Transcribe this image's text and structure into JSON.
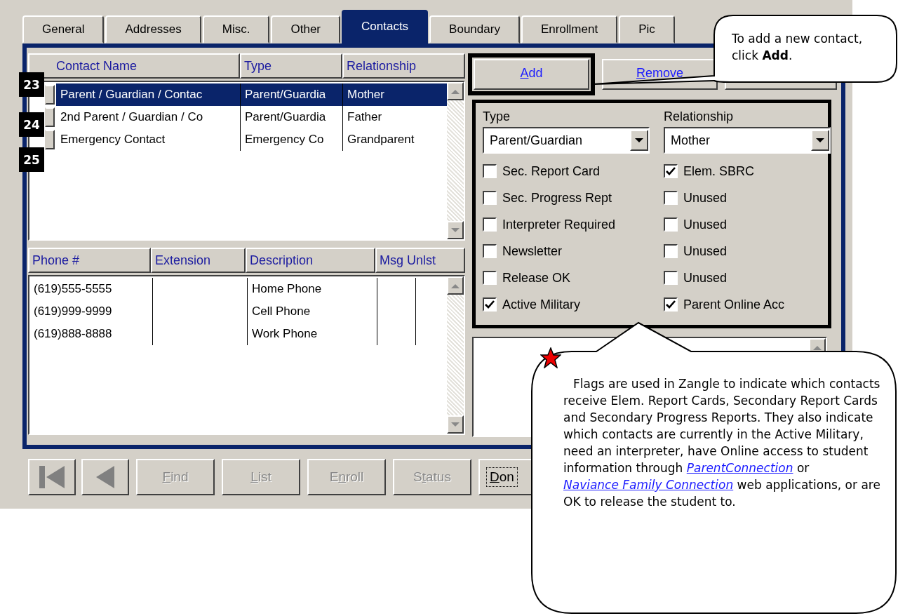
{
  "tabs": [
    {
      "label": "General",
      "selected": false
    },
    {
      "label": "Addresses",
      "selected": false
    },
    {
      "label": "Misc.",
      "selected": false
    },
    {
      "label": "Other",
      "selected": false
    },
    {
      "label": "Contacts",
      "selected": true
    },
    {
      "label": "Boundary",
      "selected": false
    },
    {
      "label": "Enrollment",
      "selected": false
    },
    {
      "label": "Pic",
      "selected": false
    }
  ],
  "contacts": {
    "columns": [
      "Contact Name",
      "Type",
      "Relationship"
    ],
    "rows": [
      {
        "name": "Parent / Guardian / Contac",
        "type": "Parent/Guardia",
        "relationship": "Mother",
        "selected": true
      },
      {
        "name": "2nd Parent / Guardian / Co",
        "type": "Parent/Guardia",
        "relationship": "Father",
        "selected": false
      },
      {
        "name": "Emergency Contact",
        "type": "Emergency Co",
        "relationship": "Grandparent",
        "selected": false
      }
    ]
  },
  "phones": {
    "columns": [
      "Phone #",
      "Extension",
      "Description",
      "Msg Unlst"
    ],
    "rows": [
      {
        "phone": "(619)555-5555",
        "description": "Home Phone"
      },
      {
        "phone": "(619)999-9999",
        "description": "Cell Phone"
      },
      {
        "phone": "(619)888-8888",
        "description": "Work Phone"
      }
    ]
  },
  "actions": [
    {
      "label": {
        "key": "A",
        "after": "dd"
      },
      "highlighted": true
    },
    {
      "label": {
        "key": "R",
        "after": "emove"
      },
      "highlighted": false
    }
  ],
  "fields": [
    {
      "label": "Type",
      "value": "Parent/Guardian"
    },
    {
      "label": "Relationship",
      "value": "Mother"
    }
  ],
  "flags": [
    {
      "label": "Sec. Report Card",
      "checked": false
    },
    {
      "label": "Elem. SBRC",
      "checked": true
    },
    {
      "label": "Sec. Progress Rept",
      "checked": false
    },
    {
      "label": "Unused",
      "checked": false
    },
    {
      "label": "Interpreter Required",
      "checked": false
    },
    {
      "label": "Unused",
      "checked": false
    },
    {
      "label": "Newsletter",
      "checked": false
    },
    {
      "label": "Unused",
      "checked": false
    },
    {
      "label": "Release OK",
      "checked": false
    },
    {
      "label": "Unused",
      "checked": false
    },
    {
      "label": "Active Military",
      "checked": true
    },
    {
      "label": "Parent Online Acc",
      "checked": true
    }
  ],
  "nav": [
    {
      "kind": "first",
      "disabled": true
    },
    {
      "kind": "previous",
      "disabled": true
    },
    {
      "kind": "text",
      "label": {
        "key": "F",
        "after": "ind"
      },
      "disabled": true
    },
    {
      "kind": "text",
      "label": {
        "key": "L",
        "after": "ist"
      },
      "disabled": true
    },
    {
      "kind": "text",
      "label": {
        "before": "E",
        "key": "n",
        "after": "roll"
      },
      "disabled": true
    },
    {
      "kind": "text",
      "label": {
        "before": "S",
        "key": "t",
        "after": "atus"
      },
      "disabled": true
    },
    {
      "kind": "text",
      "label": {
        "key": "D",
        "after": "on"
      },
      "disabled": false
    }
  ],
  "badges": [
    "23",
    "24",
    "25"
  ],
  "add_callout": {
    "text": "To add a new contact, click **Add**."
  },
  "flags_callout": {
    "segments": [
      {
        "kind": "text",
        "text": "Flags are used in Zangle to indicate which contacts receive Elem. Report Cards, Secondary Report Cards and Secondary Progress Reports. They also indicate which contacts are currently in the Active Military, need an interpreter, have Online access to student information through "
      },
      {
        "kind": "link",
        "text": "ParentConnection"
      },
      {
        "kind": "text",
        "text": " or "
      },
      {
        "kind": "link",
        "text": "Naviance Family Connection"
      },
      {
        "kind": "text",
        "text": " web applications, or are OK to release the student to."
      }
    ]
  }
}
